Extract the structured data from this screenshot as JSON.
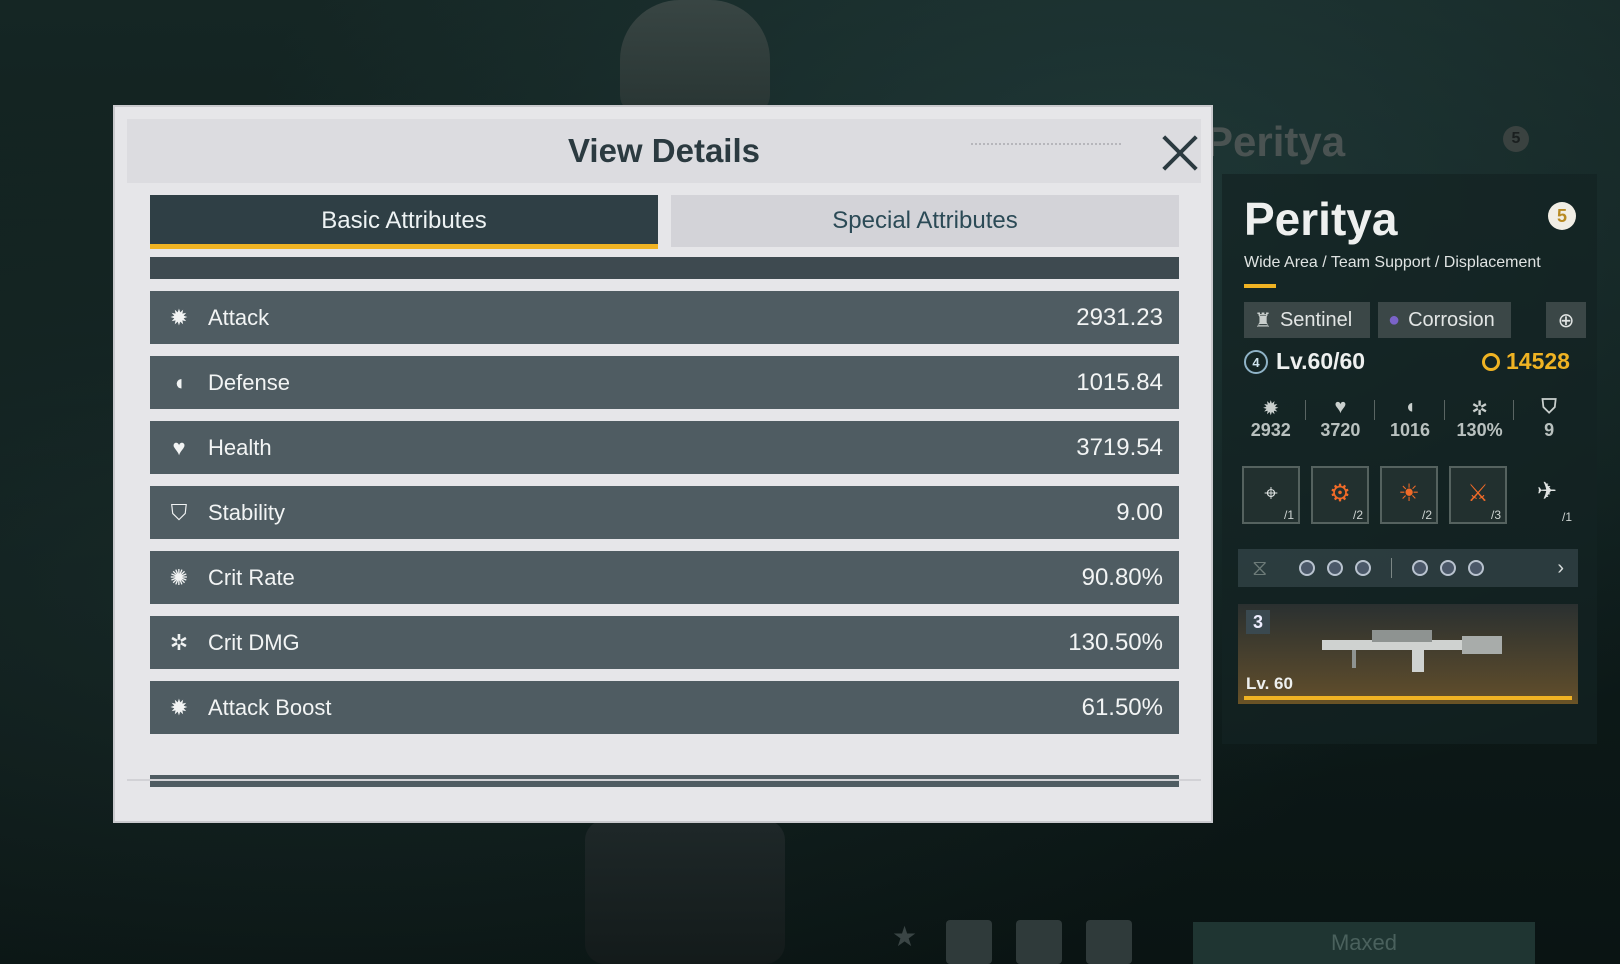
{
  "background": {
    "character_name_ghost": "Peritya",
    "rank_ghost": "5",
    "bottom_button": "Maxed"
  },
  "modal": {
    "title": "View Details",
    "tabs": [
      {
        "label": "Basic Attributes",
        "active": true
      },
      {
        "label": "Special Attributes",
        "active": false
      }
    ],
    "attributes": [
      {
        "icon": "attack-icon",
        "label": "Attack",
        "value": "2931.23"
      },
      {
        "icon": "defense-icon",
        "label": "Defense",
        "value": "1015.84"
      },
      {
        "icon": "health-icon",
        "label": "Health",
        "value": "3719.54"
      },
      {
        "icon": "stability-icon",
        "label": "Stability",
        "value": "9.00"
      },
      {
        "icon": "crit-rate-icon",
        "label": "Crit Rate",
        "value": "90.80%"
      },
      {
        "icon": "crit-dmg-icon",
        "label": "Crit DMG",
        "value": "130.50%"
      },
      {
        "icon": "attack-boost-icon",
        "label": "Attack Boost",
        "value": "61.50%"
      }
    ]
  },
  "character": {
    "name": "Peritya",
    "rank": "5",
    "roles": "Wide Area / Team Support / Displacement",
    "class_tag": "Sentinel",
    "element_tag": "Corrosion",
    "level_badge": "4",
    "level": "Lv.60/60",
    "power": "14528",
    "stats": [
      {
        "icon": "attack-icon",
        "value": "2932"
      },
      {
        "icon": "health-icon",
        "value": "3720"
      },
      {
        "icon": "defense-icon",
        "value": "1016"
      },
      {
        "icon": "crit-dmg-icon",
        "value": "130%"
      },
      {
        "icon": "stability-icon",
        "value": "9"
      }
    ],
    "mods": [
      {
        "icon": "crosshair-icon",
        "count": "/1"
      },
      {
        "icon": "mod-gauge-icon",
        "count": "/2"
      },
      {
        "icon": "mod-sun-icon",
        "count": "/2"
      },
      {
        "icon": "mod-blade-icon",
        "count": "/3"
      },
      {
        "icon": "mod-wing-icon",
        "count": "/1"
      }
    ],
    "weapon": {
      "slot": "3",
      "level": "Lv. 60"
    },
    "colors": {
      "accent": "#f0b323",
      "corrosion": "#7a63c8"
    }
  }
}
